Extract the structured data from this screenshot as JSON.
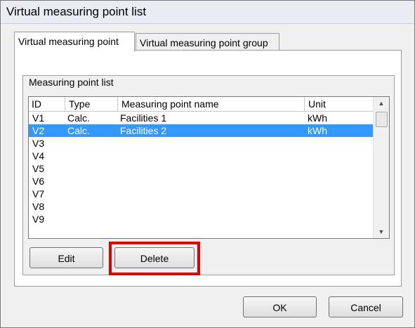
{
  "window": {
    "title": "Virtual measuring point list"
  },
  "tabs": [
    {
      "label": "Virtual measuring point",
      "active": true
    },
    {
      "label": "Virtual measuring point group",
      "active": false
    }
  ],
  "group": {
    "title": "Measuring point list"
  },
  "columns": [
    "ID",
    "Type",
    "Measuring point name",
    "Unit"
  ],
  "rows": [
    {
      "id": "V1",
      "type": "Calc.",
      "name": "Facilities 1",
      "unit": "kWh",
      "selected": false
    },
    {
      "id": "V2",
      "type": "Calc.",
      "name": "Facilities 2",
      "unit": "kWh",
      "selected": true
    },
    {
      "id": "V3",
      "type": "",
      "name": "",
      "unit": "",
      "selected": false
    },
    {
      "id": "V4",
      "type": "",
      "name": "",
      "unit": "",
      "selected": false
    },
    {
      "id": "V5",
      "type": "",
      "name": "",
      "unit": "",
      "selected": false
    },
    {
      "id": "V6",
      "type": "",
      "name": "",
      "unit": "",
      "selected": false
    },
    {
      "id": "V7",
      "type": "",
      "name": "",
      "unit": "",
      "selected": false
    },
    {
      "id": "V8",
      "type": "",
      "name": "",
      "unit": "",
      "selected": false
    },
    {
      "id": "V9",
      "type": "",
      "name": "",
      "unit": "",
      "selected": false
    }
  ],
  "buttons": {
    "edit": "Edit",
    "delete": "Delete",
    "ok": "OK",
    "cancel": "Cancel"
  },
  "colors": {
    "selection": "#3399ff",
    "highlight_box": "#e00000"
  },
  "icons": {
    "scroll_up": "scroll-up-arrow-icon",
    "scroll_down": "scroll-down-arrow-icon"
  }
}
